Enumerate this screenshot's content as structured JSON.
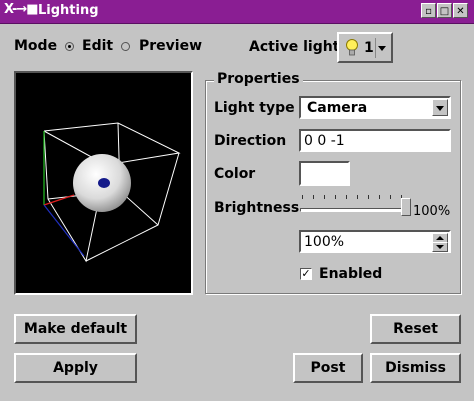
{
  "window": {
    "title": "Lighting",
    "logo": "X-→■"
  },
  "mode": {
    "label": "Mode",
    "options": [
      "Edit",
      "Preview"
    ],
    "selected": "Edit"
  },
  "active_light": {
    "label": "Active light",
    "value": "1",
    "icon": "lightbulb-icon"
  },
  "properties": {
    "title": "Properties",
    "light_type": {
      "label": "Light type",
      "value": "Camera"
    },
    "direction": {
      "label": "Direction",
      "value": "0 0 -1"
    },
    "color": {
      "label": "Color",
      "swatch": "#ffffff"
    },
    "brightness": {
      "label": "Brightness",
      "slider_readout": "100%",
      "spin_value": "100%",
      "level": 1.0
    },
    "enabled": {
      "label": "Enabled",
      "checked": true
    }
  },
  "buttons": {
    "make_default": "Make default",
    "reset": "Reset",
    "apply": "Apply",
    "post": "Post",
    "dismiss": "Dismiss"
  },
  "colors": {
    "titlebar": "#8a1e93",
    "background": "#c4c4c4"
  }
}
